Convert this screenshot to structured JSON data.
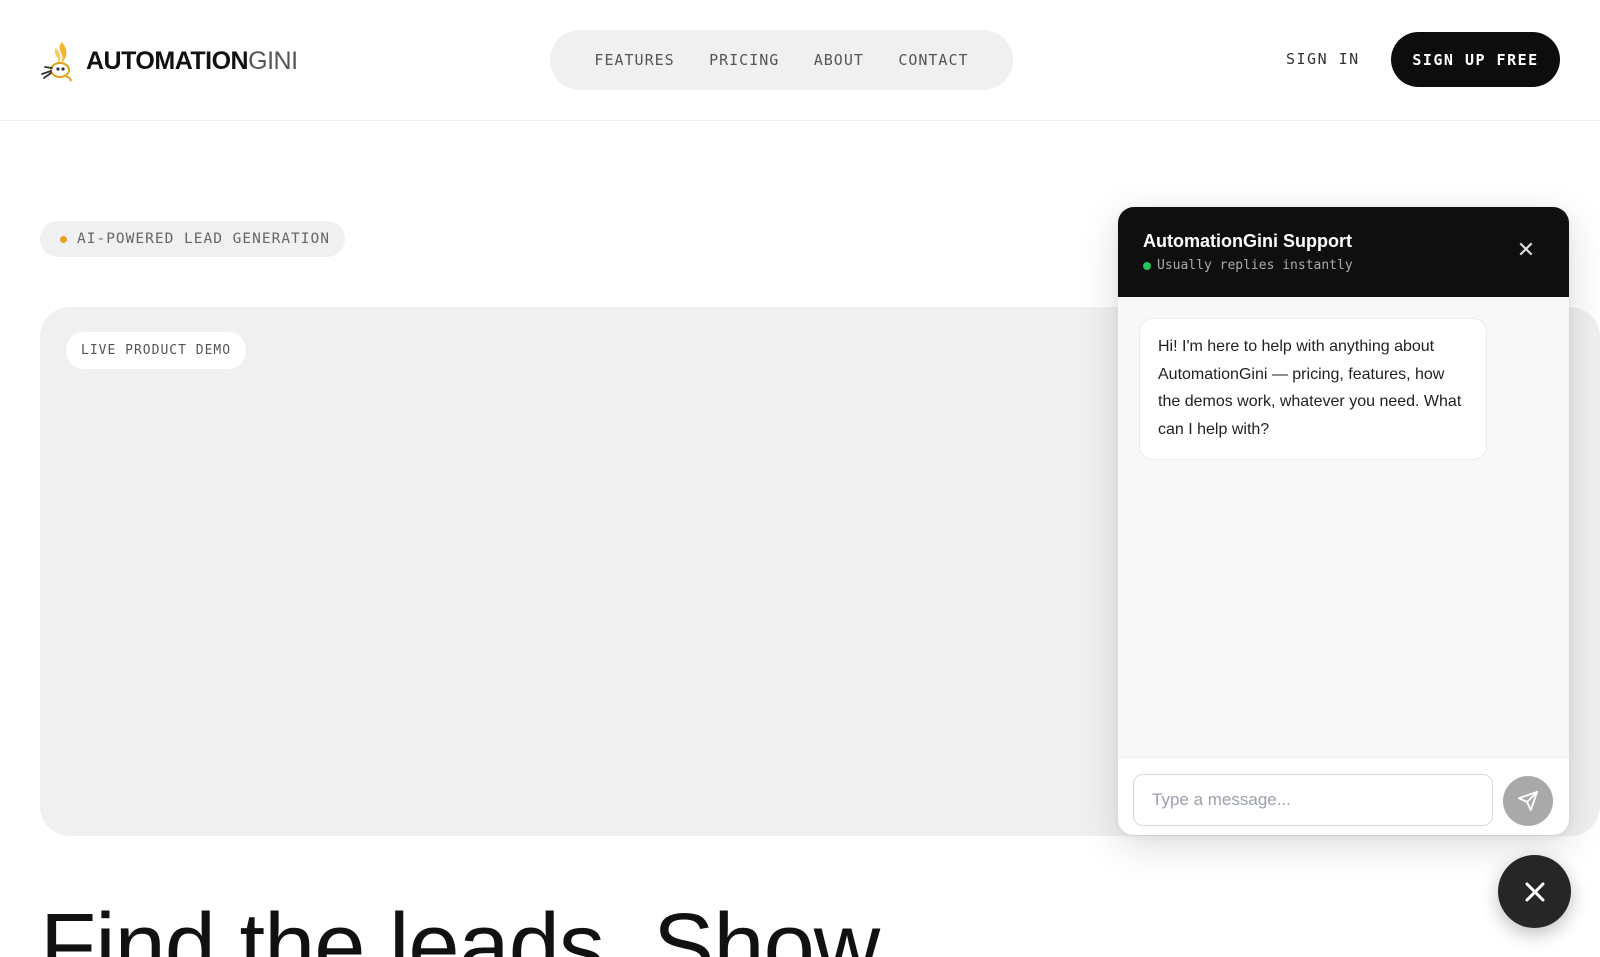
{
  "brand": {
    "name_dark": "AUTOMATION",
    "name_grey": "GINI",
    "logo_icon": "genie-lamp-icon"
  },
  "nav": {
    "items": [
      "FEATURES",
      "PRICING",
      "ABOUT",
      "CONTACT"
    ]
  },
  "header": {
    "sign_in": "SIGN IN",
    "sign_up": "SIGN UP FREE"
  },
  "badge": {
    "text": "AI-POWERED LEAD GENERATION",
    "dot_color": "#e8a020"
  },
  "demo": {
    "label": "LIVE PRODUCT DEMO"
  },
  "hero": {
    "title": "Find the leads. Show"
  },
  "chat": {
    "title": "AutomationGini Support",
    "status": "Usually replies instantly",
    "status_color": "#22c55e",
    "close_icon": "close-icon",
    "message": "Hi! I'm here to help with anything about AutomationGini — pricing, features, how the demos work, whatever you need. What can I help with?",
    "input_placeholder": "Type a message...",
    "send_icon": "send-icon"
  },
  "fab": {
    "icon": "close-icon"
  }
}
